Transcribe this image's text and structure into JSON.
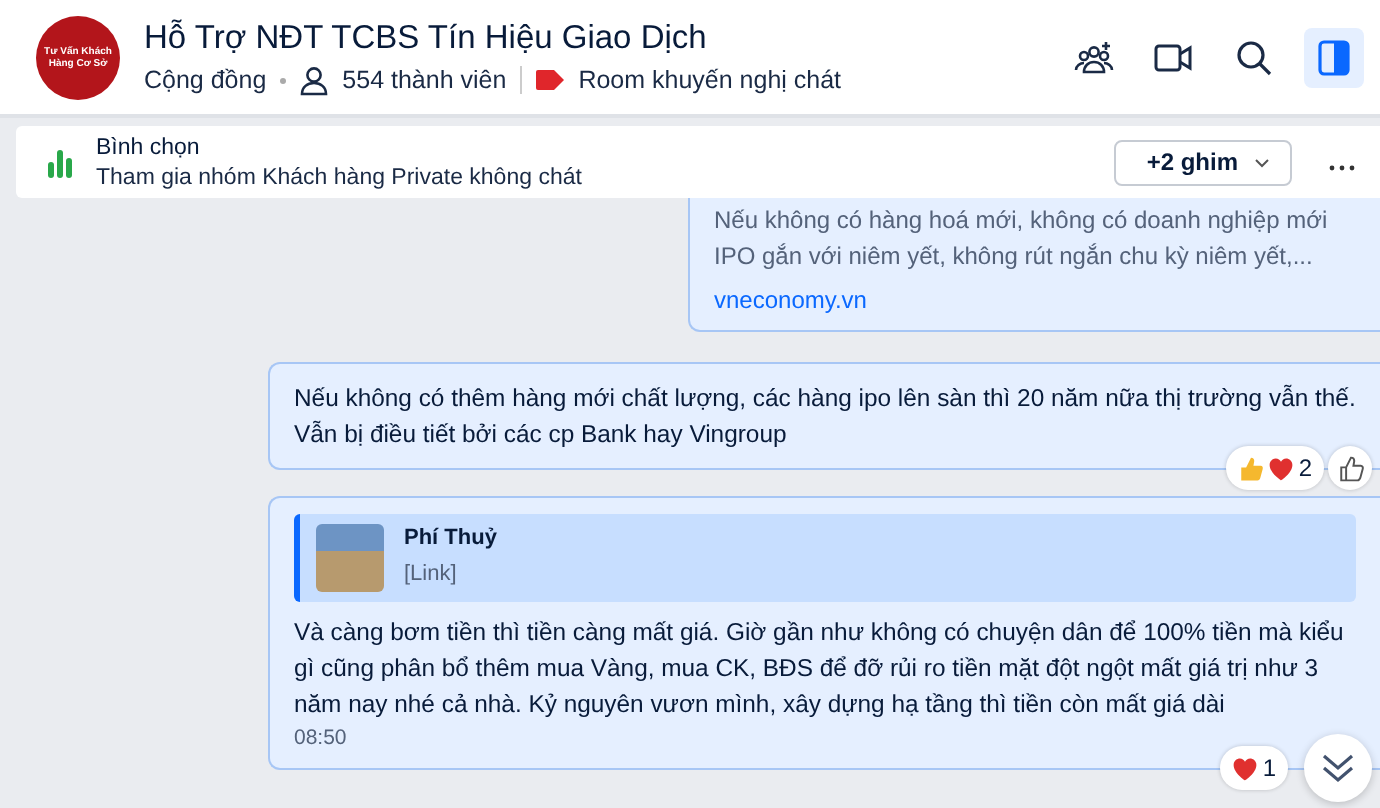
{
  "header": {
    "avatar_text": "Tư Vấn Khách Hàng Cơ Sở",
    "title": "Hỗ Trợ NĐT TCBS Tín Hiệu Giao Dịch",
    "category": "Cộng đồng",
    "members": "554 thành viên",
    "tag": "Room khuyến nghị chát",
    "panel_toggle": {
      "selected": true
    }
  },
  "pinned": {
    "label": "Bình chọn",
    "text": "Tham gia nhóm Khách hàng Private không chát",
    "more_pins": "+2 ghim"
  },
  "messages": [
    {
      "kind": "link_preview",
      "text": "Nếu không có hàng hoá mới, không có doanh nghiệp mới IPO gắn với niêm yết, không rút ngắn chu kỳ niêm yết,...",
      "source": "vneconomy.vn"
    },
    {
      "kind": "text",
      "text": "Nếu không có thêm hàng mới chất lượng, các hàng ipo lên sàn thì 20 năm nữa thị trường vẫn thế. Vẫn bị điều tiết bởi các cp Bank hay Vingroup",
      "reactions": [
        {
          "kind": "like"
        },
        {
          "kind": "heart"
        }
      ],
      "reaction_count": "2"
    },
    {
      "kind": "quote",
      "quote_author": "Phí Thuỷ",
      "quote_text": "[Link]",
      "text": "Và càng bơm tiền thì tiền càng mất giá. Giờ gần như không có chuyện dân để 100% tiền mà kiểu gì cũng phân bổ thêm mua Vàng, mua CK, BĐS để đỡ rủi ro tiền mặt đột ngột mất giá trị như 3 năm nay nhé cả nhà. Kỷ nguyên vươn mình, xây dựng hạ tầng thì tiền còn mất giá dài",
      "time": "08:50",
      "reactions": [
        {
          "kind": "heart"
        }
      ],
      "reaction_count": "1"
    }
  ]
}
